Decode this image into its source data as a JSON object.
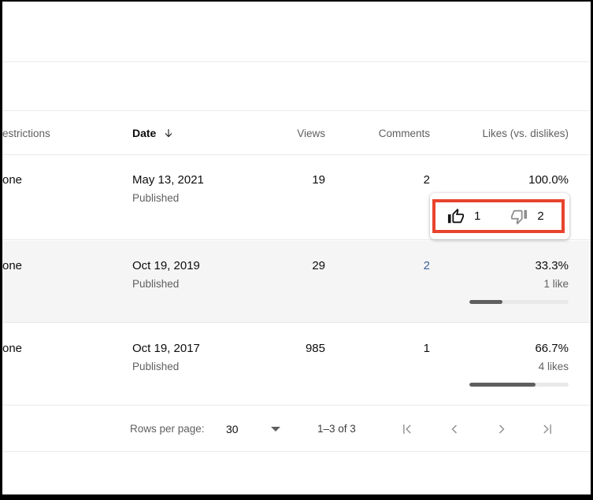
{
  "table": {
    "columns": {
      "restrictions": "estrictions",
      "date": "Date",
      "views": "Views",
      "comments": "Comments",
      "likes": "Likes (vs. dislikes)"
    },
    "rows": [
      {
        "restrictions": "one",
        "date": "May 13, 2021",
        "visibility": "Published",
        "views": "19",
        "comments": "2",
        "likes_pct": "100.0%"
      },
      {
        "restrictions": "one",
        "date": "Oct 19, 2019",
        "visibility": "Published",
        "views": "29",
        "comments": "2",
        "likes_pct": "33.3%",
        "likes_label": "1 like",
        "likes_ratio": 0.333
      },
      {
        "restrictions": "one",
        "date": "Oct 19, 2017",
        "visibility": "Published",
        "views": "985",
        "comments": "1",
        "likes_pct": "66.7%",
        "likes_label": "4 likes",
        "likes_ratio": 0.667
      }
    ]
  },
  "tooltip": {
    "likes_count": "1",
    "dislikes_count": "2"
  },
  "footer": {
    "rows_per_page_label": "Rows per page:",
    "rows_per_page_value": "30",
    "range_label": "1–3 of 3"
  },
  "colors": {
    "annotation_red": "#e8432d",
    "comment_link_blue": "#3d6199",
    "bar_fill": "#5f5f5f",
    "bar_track": "#e9e9e9"
  }
}
